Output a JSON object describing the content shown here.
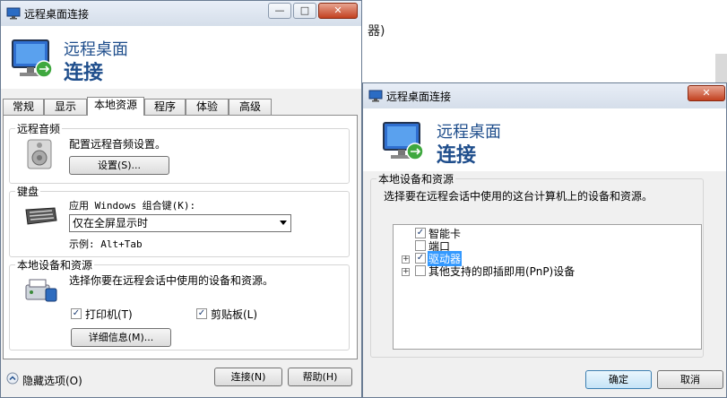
{
  "background": {
    "partial_text": "器)"
  },
  "main_window": {
    "title": "远程桌面连接",
    "header_line1": "远程桌面",
    "header_line2": "连接",
    "controls": {
      "minimize": "—",
      "maximize": "□",
      "close": "✕"
    },
    "tabs": [
      {
        "label": "常规"
      },
      {
        "label": "显示"
      },
      {
        "label": "本地资源"
      },
      {
        "label": "程序"
      },
      {
        "label": "体验"
      },
      {
        "label": "高级"
      }
    ],
    "audio": {
      "title": "远程音频",
      "desc": "配置远程音频设置。",
      "settings_button": "设置(S)..."
    },
    "keyboard": {
      "title": "键盘",
      "desc": "应用 Windows 组合键(K):",
      "selected": "仅在全屏显示时",
      "example": "示例: Alt+Tab"
    },
    "local_devices": {
      "title": "本地设备和资源",
      "desc": "选择你要在远程会话中使用的设备和资源。",
      "printer": "打印机(T)",
      "clipboard": "剪贴板(L)",
      "details_button": "详细信息(M)..."
    },
    "footer": {
      "hide_options": "隐藏选项(O)",
      "connect": "连接(N)",
      "help": "帮助(H)"
    }
  },
  "dialog": {
    "title": "远程桌面连接",
    "header_line1": "远程桌面",
    "header_line2": "连接",
    "controls": {
      "close": "✕"
    },
    "group_title": "本地设备和资源",
    "desc": "选择要在远程会话中使用的这台计算机上的设备和资源。",
    "items": [
      {
        "label": "智能卡",
        "checked": true,
        "expandable": false
      },
      {
        "label": "端口",
        "checked": false,
        "expandable": false
      },
      {
        "label": "驱动器",
        "checked": true,
        "expandable": true,
        "selected": true
      },
      {
        "label": "其他支持的即插即用(PnP)设备",
        "checked": false,
        "expandable": true
      }
    ],
    "ok": "确定",
    "cancel": "取消"
  }
}
